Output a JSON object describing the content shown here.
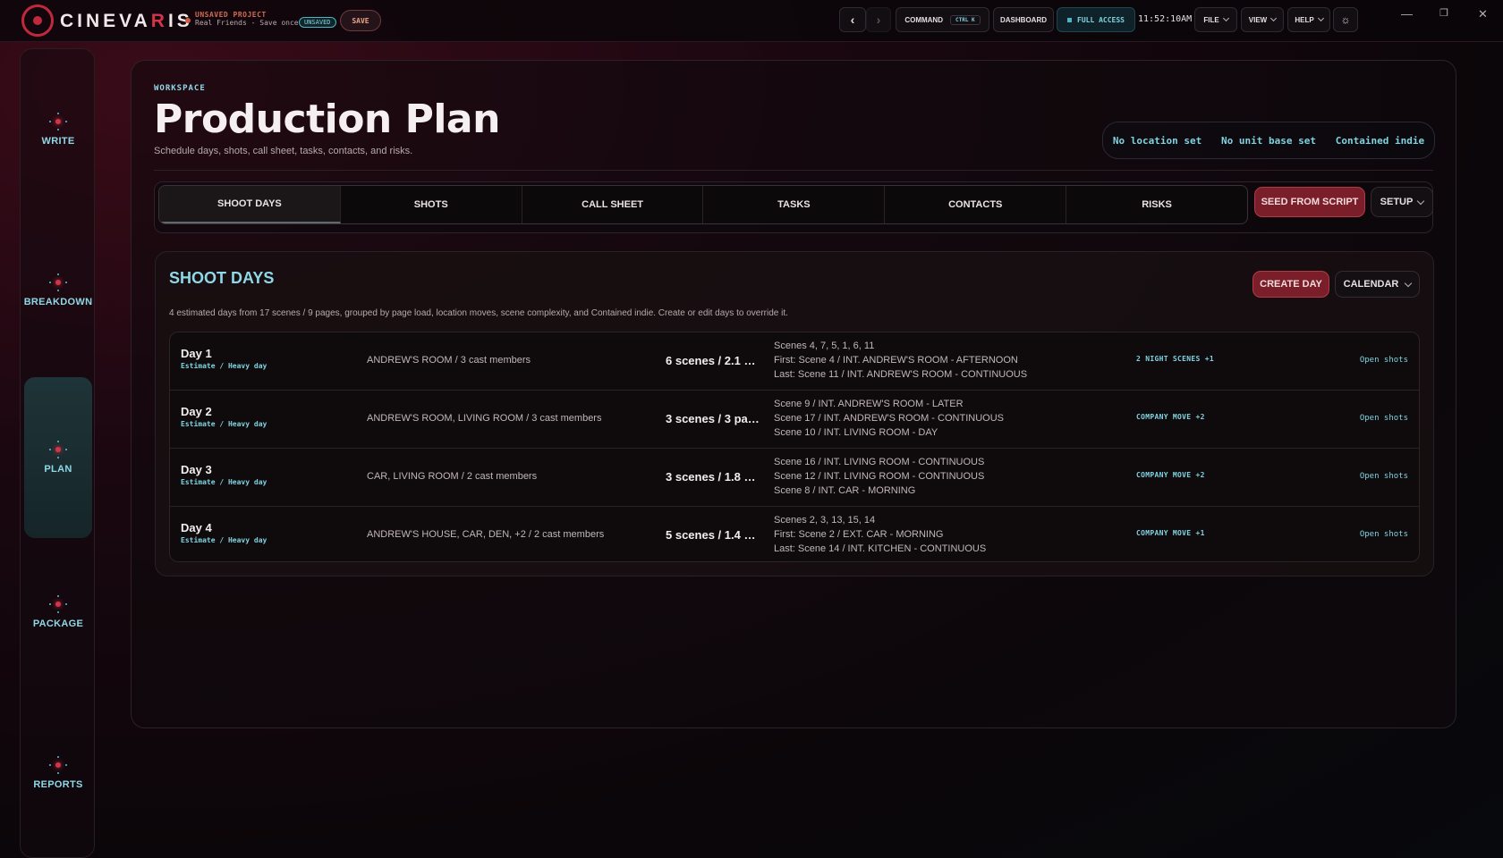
{
  "app": {
    "brand_prefix": "CINEVA",
    "brand_accent": "R",
    "brand_suffix": "IS",
    "project_title": "UNSAVED PROJECT",
    "project_sub": "Real Friends - Save once t…",
    "unsaved_badge": "UNSAVED",
    "save_label": "SAVE"
  },
  "toolbar": {
    "command_label": "COMMAND",
    "command_shortcut": "CTRL K",
    "dashboard_label": "DASHBOARD",
    "access_label": "FULL ACCESS",
    "clock": "11:52:10AM",
    "file_label": "FILE",
    "view_label": "VIEW",
    "help_label": "HELP"
  },
  "sidebar": {
    "items": [
      {
        "label": "WRITE"
      },
      {
        "label": "BREAKDOWN"
      },
      {
        "label": "PLAN",
        "active": true
      },
      {
        "label": "PACKAGE"
      },
      {
        "label": "REPORTS"
      }
    ]
  },
  "header": {
    "kicker": "WORKSPACE",
    "title": "Production Plan",
    "subtitle": "Schedule days, shots, call sheet, tasks, contacts, and risks.",
    "chips": [
      "No location set",
      "No unit base set",
      "Contained indie"
    ]
  },
  "tabs": [
    {
      "label": "SHOOT DAYS",
      "active": true
    },
    {
      "label": "SHOTS"
    },
    {
      "label": "CALL SHEET"
    },
    {
      "label": "TASKS"
    },
    {
      "label": "CONTACTS"
    },
    {
      "label": "RISKS"
    }
  ],
  "actions": {
    "seed_label": "SEED FROM SCRIPT",
    "setup_label": "SETUP"
  },
  "shoot_days": {
    "title": "SHOOT DAYS",
    "create_label": "CREATE DAY",
    "calendar_label": "CALENDAR",
    "note": "4 estimated days from 17 scenes / 9 pages, grouped by page load, location moves, scene complexity, and Contained indie. Create or edit days to override it.",
    "rows": [
      {
        "day": "Day 1",
        "meta": "Estimate / Heavy day",
        "location": "ANDREW'S ROOM / 3 cast members",
        "scenes": "6 scenes / 2.1 …",
        "details": [
          "Scenes 4, 7, 5, 1, 6, 11",
          "First: Scene 4 / INT. ANDREW'S ROOM - AFTERNOON",
          "Last: Scene 11 / INT. ANDREW'S ROOM - CONTINUOUS"
        ],
        "flag": "2 NIGHT SCENES +1",
        "open": "Open shots"
      },
      {
        "day": "Day 2",
        "meta": "Estimate / Heavy day",
        "location": "ANDREW'S ROOM, LIVING ROOM / 3 cast members",
        "scenes": "3 scenes / 3 pa…",
        "details": [
          "Scene 9 / INT. ANDREW'S ROOM - LATER",
          "Scene 17 / INT. ANDREW'S ROOM - CONTINUOUS",
          "Scene 10 / INT. LIVING ROOM - DAY"
        ],
        "flag": "COMPANY MOVE +2",
        "open": "Open shots"
      },
      {
        "day": "Day 3",
        "meta": "Estimate / Heavy day",
        "location": "CAR, LIVING ROOM / 2 cast members",
        "scenes": "3 scenes / 1.8 …",
        "details": [
          "Scene 16 / INT. LIVING ROOM - CONTINUOUS",
          "Scene 12 / INT. LIVING ROOM - CONTINUOUS",
          "Scene 8 / INT. CAR - MORNING"
        ],
        "flag": "COMPANY MOVE +2",
        "open": "Open shots"
      },
      {
        "day": "Day 4",
        "meta": "Estimate / Heavy day",
        "location": "ANDREW'S HOUSE, CAR, DEN, +2 / 2 cast members",
        "scenes": "5 scenes / 1.4 …",
        "details": [
          "Scenes 2, 3, 13, 15, 14",
          "First: Scene 2 / EXT. CAR - MORNING",
          "Last: Scene 14 / INT. KITCHEN - CONTINUOUS"
        ],
        "flag": "COMPANY MOVE +1",
        "open": "Open shots"
      }
    ]
  },
  "colors": {
    "accent_red": "#c2283d",
    "accent_cyan": "#7fd3e0",
    "background": "#0b0609"
  },
  "icons": [
    "back-arrow-icon",
    "forward-arrow-icon",
    "theme-icon",
    "minimize-icon",
    "maximize-icon",
    "close-icon"
  ]
}
